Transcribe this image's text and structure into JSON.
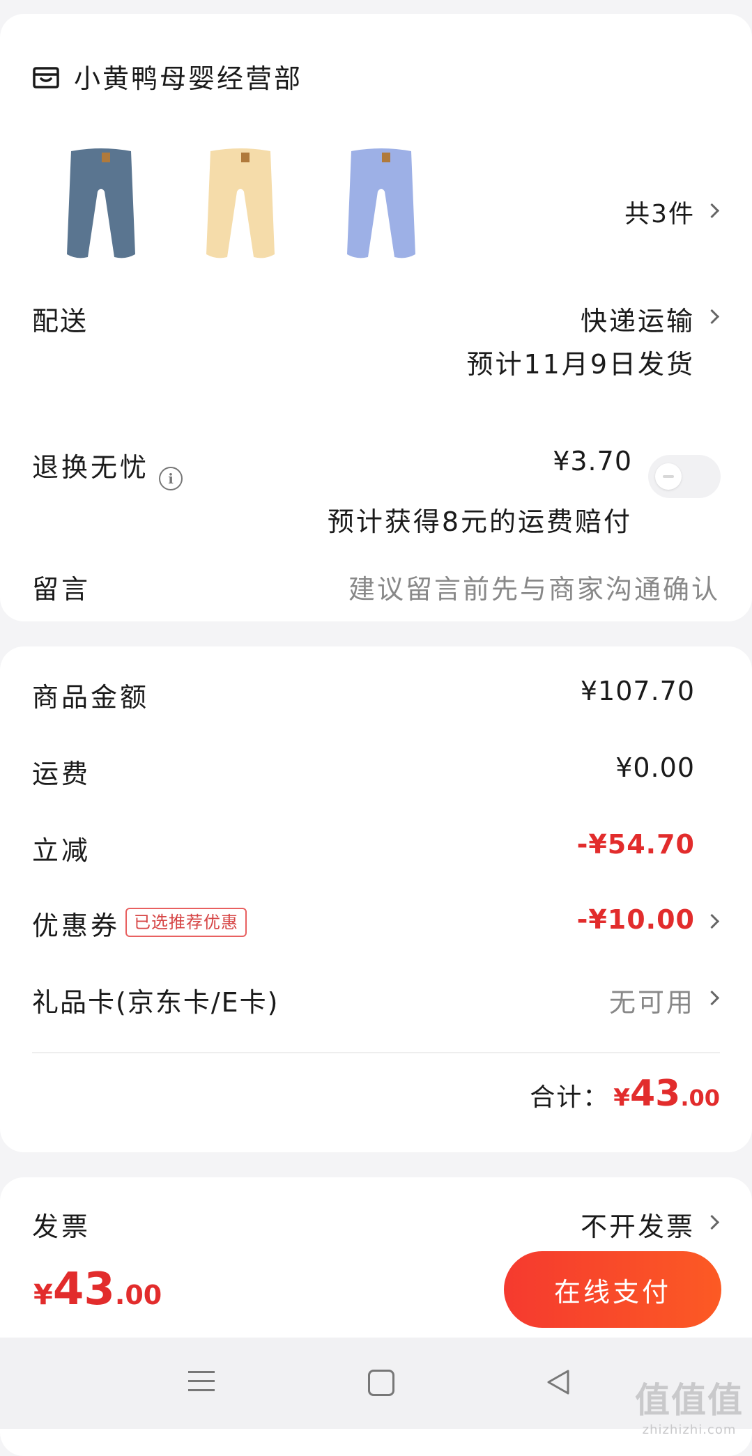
{
  "store": {
    "name": "小黄鸭母婴经营部",
    "icon": "store-icon"
  },
  "products": {
    "count_label": "共3件",
    "items": [
      {
        "color_name": "blue-gray",
        "color": "#5a7590"
      },
      {
        "color_name": "cream",
        "color": "#f5dcaa"
      },
      {
        "color_name": "light-blue",
        "color": "#9db0e6"
      }
    ]
  },
  "shipping": {
    "label": "配送",
    "method": "快递运输",
    "eta": "预计11月9日发货"
  },
  "return_insurance": {
    "label": "退换无忧",
    "price": "¥3.70",
    "note": "预计获得8元的运费赔付",
    "enabled": false
  },
  "message": {
    "label": "留言",
    "placeholder": "建议留言前先与商家沟通确认"
  },
  "summary": {
    "goods_label": "商品金额",
    "goods_value": "¥107.70",
    "freight_label": "运费",
    "freight_value": "¥0.00",
    "discount_label": "立减",
    "discount_value": "-¥54.70",
    "coupon_label": "优惠券",
    "coupon_badge": "已选推荐优惠",
    "coupon_value": "-¥10.00",
    "giftcard_label": "礼品卡(京东卡/E卡)",
    "giftcard_value": "无可用",
    "total_label": "合计：",
    "total_currency": "¥",
    "total_int": "43",
    "total_dec": ".00"
  },
  "invoice": {
    "label": "发票",
    "value": "不开发票"
  },
  "paybar": {
    "currency": "¥",
    "amount_int": "43",
    "amount_dec": ".00",
    "button_label": "在线支付"
  },
  "watermark": {
    "big": "值值值",
    "small": "zhizhizhi.com"
  },
  "colors": {
    "accent_red": "#e22c2c",
    "button_start": "#f53a2f",
    "button_end": "#fc5a24"
  }
}
